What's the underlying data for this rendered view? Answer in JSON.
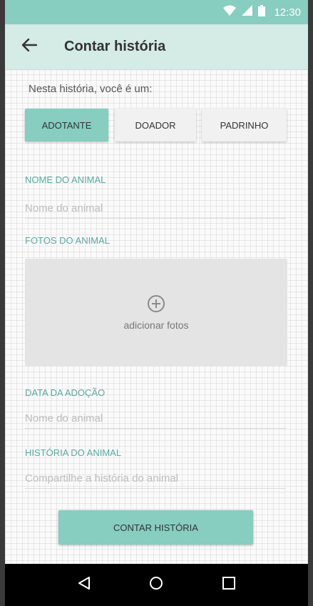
{
  "status_bar": {
    "time": "12:30",
    "icons": [
      "wifi-icon",
      "signal-icon",
      "battery-icon"
    ]
  },
  "app_bar": {
    "title": "Contar história",
    "back_icon": "arrow-back-icon"
  },
  "role_section": {
    "prompt": "Nesta história, você é um:",
    "options": [
      {
        "label": "ADOTANTE",
        "selected": true
      },
      {
        "label": "DOADOR",
        "selected": false
      },
      {
        "label": "PADRINHO",
        "selected": false
      }
    ]
  },
  "fields": {
    "animal_name": {
      "label": "NOME DO ANIMAL",
      "placeholder": "Nome do animal",
      "value": ""
    },
    "photos": {
      "label": "FOTOS DO ANIMAL",
      "add_label": "adicionar fotos",
      "icon": "add-circle-icon"
    },
    "adoption_date": {
      "label": "DATA DA ADOÇÃO",
      "placeholder": "Nome do animal",
      "value": ""
    },
    "story": {
      "label": "HISTÓRIA DO ANIMAL",
      "placeholder": "Compartilhe a história do animal",
      "value": ""
    }
  },
  "submit": {
    "label": "CONTAR HISTÓRIA"
  },
  "nav_bar": {
    "icons": [
      "back-triangle-icon",
      "home-circle-icon",
      "recents-square-icon"
    ]
  },
  "colors": {
    "accent": "#87cdc0",
    "app_bar": "#d4ebe6",
    "label": "#5ca9a0",
    "photo_box": "#e4e4e4"
  }
}
